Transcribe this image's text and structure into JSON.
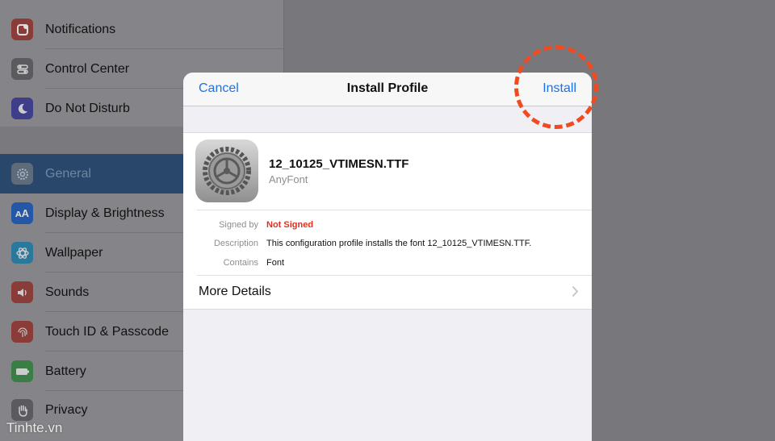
{
  "sidebar": {
    "items": [
      {
        "label": "Notifications",
        "icon": "notifications-icon",
        "color": "#e4433d"
      },
      {
        "label": "Control Center",
        "icon": "control-center-icon",
        "color": "#8e8e93"
      },
      {
        "label": "Do Not Disturb",
        "icon": "moon-icon",
        "color": "#5856d6"
      },
      {
        "label": "General",
        "icon": "gear-icon",
        "color": "#8e8e93",
        "selected": true
      },
      {
        "label": "Display & Brightness",
        "icon": "display-icon",
        "color": "#1a73e8"
      },
      {
        "label": "Wallpaper",
        "icon": "wallpaper-icon",
        "color": "#34aadc"
      },
      {
        "label": "Sounds",
        "icon": "speaker-icon",
        "color": "#e4433d"
      },
      {
        "label": "Touch ID & Passcode",
        "icon": "fingerprint-icon",
        "color": "#e4433d"
      },
      {
        "label": "Battery",
        "icon": "battery-icon",
        "color": "#4cd964"
      },
      {
        "label": "Privacy",
        "icon": "hand-icon",
        "color": "#8e8e93"
      }
    ]
  },
  "watermark": "Tinhte.vn",
  "modal": {
    "cancel_label": "Cancel",
    "title": "Install Profile",
    "install_label": "Install",
    "profile_name": "12_10125_VTIMESN.TTF",
    "profile_org": "AnyFont",
    "details": [
      {
        "key": "Signed by",
        "value": "Not Signed"
      },
      {
        "key": "Description",
        "value": "This configuration profile installs the font 12_10125_VTIMESN.TTF."
      },
      {
        "key": "Contains",
        "value": "Font"
      }
    ],
    "more_details_label": "More Details"
  },
  "colors": {
    "accent": "#1a73e8",
    "warning": "#e0301e",
    "annotation": "#f04a21"
  }
}
